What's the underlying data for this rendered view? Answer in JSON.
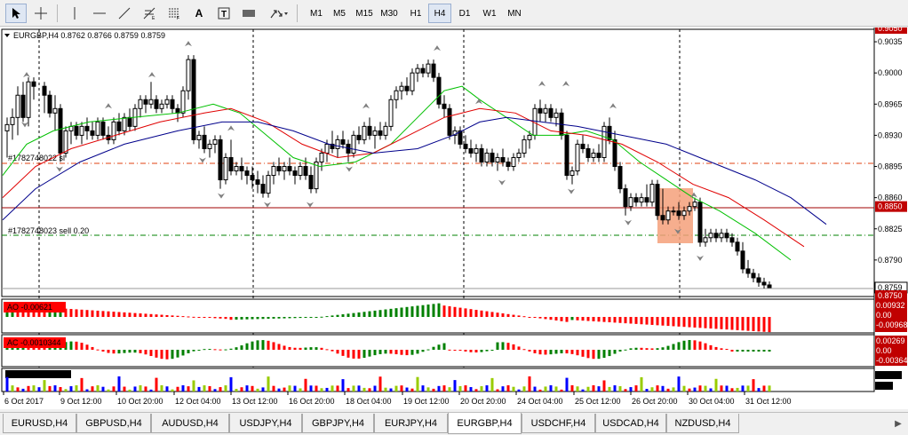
{
  "toolbar": {
    "tools": [
      {
        "name": "cursor-icon",
        "glyph": "➚"
      },
      {
        "name": "crosshair-icon",
        "glyph": "+"
      },
      {
        "name": "vertical-line-icon",
        "glyph": "|"
      },
      {
        "name": "horizontal-line-icon",
        "glyph": "—"
      },
      {
        "name": "trendline-icon",
        "glyph": "╱"
      },
      {
        "name": "fibonacci-icon",
        "glyph": "≢"
      },
      {
        "name": "fibonacci-fan-icon",
        "glyph": "▤"
      },
      {
        "name": "text-icon",
        "glyph": "A"
      },
      {
        "name": "text-label-icon",
        "glyph": "T"
      },
      {
        "name": "rectangle-icon",
        "glyph": "▬"
      },
      {
        "name": "arrows-icon",
        "glyph": "➶"
      }
    ],
    "timeframes": [
      "M1",
      "M5",
      "M15",
      "M30",
      "H1",
      "H4",
      "D1",
      "W1",
      "MN"
    ],
    "active_timeframe": "H4"
  },
  "chart": {
    "header": "EURGBP,H4  0.8762 0.8766 0.8759 0.8759",
    "order_labels": [
      "#1782748022 sl",
      "#1782748023 sell 0.20"
    ],
    "price_labels": [
      "0.9050",
      "0.9035",
      "0.9000",
      "0.8965",
      "0.8930",
      "0.8895",
      "0.8860",
      "0.8850",
      "0.8825",
      "0.8790",
      "0.8759",
      "0.8750"
    ],
    "ao": {
      "label": "AO -0.00621",
      "scale": [
        "0.00932",
        "0.00",
        "-0.00968"
      ]
    },
    "ac": {
      "label": "AC -0.0010344",
      "scale": [
        "0.00269",
        "0.00",
        "-0.00364"
      ]
    },
    "dates": [
      "6 Oct 2017",
      "9 Oct 12:00",
      "10 Oct 20:00",
      "12 Oct 04:00",
      "13 Oct 12:00",
      "16 Oct 20:00",
      "18 Oct 04:00",
      "19 Oct 12:00",
      "20 Oct 20:00",
      "24 Oct 04:00",
      "25 Oct 12:00",
      "26 Oct 20:00",
      "30 Oct 04:00",
      "31 Oct 12:00"
    ],
    "colors": {
      "bull": "#ffffff",
      "bear": "#000000",
      "ma_green": "#00c000",
      "ma_red": "#e00000",
      "ma_blue": "#00008b",
      "highlight": "#f4a07a",
      "price_badge": "#c00000",
      "ao_up": "#008000",
      "ao_down": "#ff0000"
    }
  },
  "tabs": {
    "items": [
      "EURUSD,H4",
      "GBPUSD,H4",
      "AUDUSD,H4",
      "USDJPY,H4",
      "GBPJPY,H4",
      "EURJPY,H4",
      "EURGBP,H4",
      "USDCHF,H4",
      "USDCAD,H4",
      "NZDUSD,H4"
    ],
    "active": "EURGBP,H4"
  }
}
